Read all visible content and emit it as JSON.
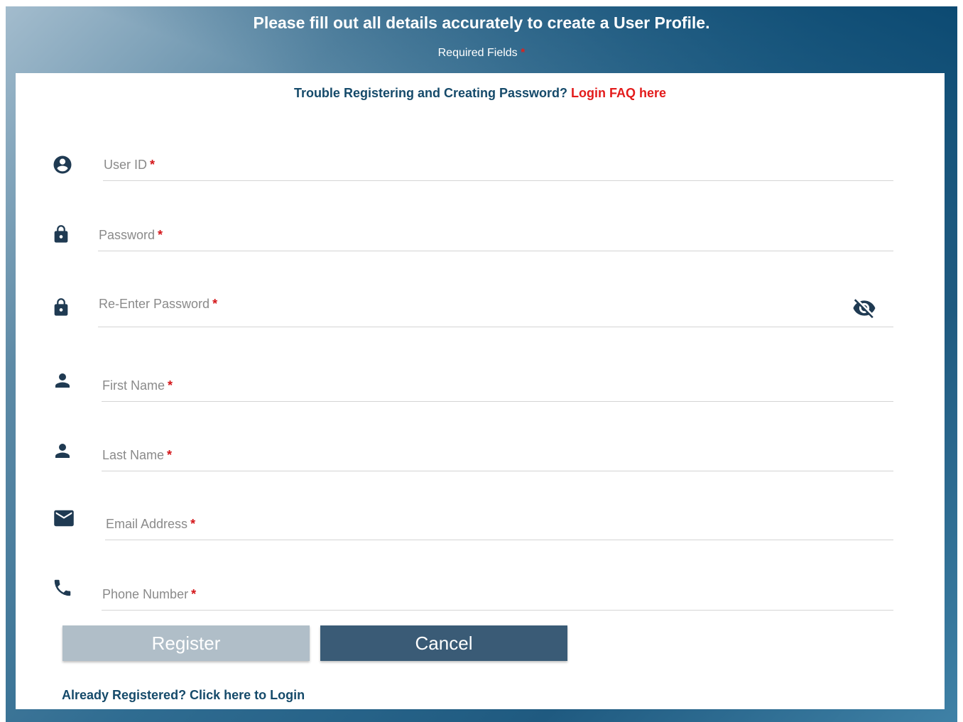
{
  "header": {
    "title": "Please fill out all details accurately to create a User Profile.",
    "required_label": "Required Fields",
    "required_marker": "*"
  },
  "help": {
    "text": "Trouble Registering and Creating Password?",
    "link_label": "Login FAQ here"
  },
  "fields": {
    "user_id": {
      "label": "User ID",
      "icon": "account-circle-icon"
    },
    "password": {
      "label": "Password",
      "icon": "lock-icon"
    },
    "reenter_password": {
      "label": "Re-Enter Password",
      "icon": "lock-icon",
      "toggle_icon": "eye-off-icon"
    },
    "first_name": {
      "label": "First Name",
      "icon": "person-icon"
    },
    "last_name": {
      "label": "Last Name",
      "icon": "person-icon"
    },
    "email": {
      "label": "Email Address",
      "icon": "mail-icon"
    },
    "phone": {
      "label": "Phone Number",
      "icon": "phone-icon"
    }
  },
  "buttons": {
    "register": "Register",
    "cancel": "Cancel"
  },
  "footer": {
    "login_link": "Already Registered? Click here to Login"
  },
  "colors": {
    "accent_dark": "#154a6a",
    "required": "#e31b1b",
    "register_disabled": "#b0bec8",
    "cancel": "#3a5b76"
  }
}
